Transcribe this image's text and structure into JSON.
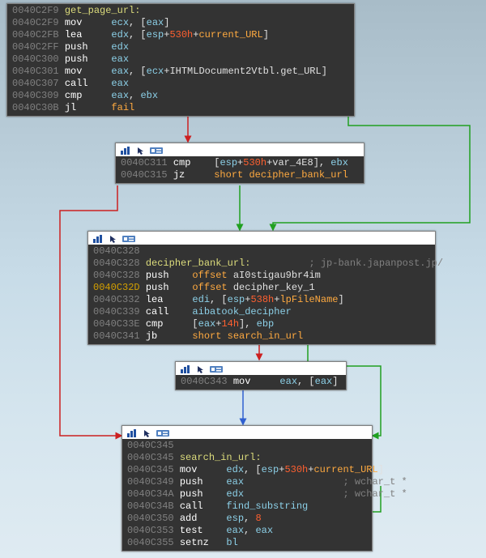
{
  "block1": {
    "rows": [
      {
        "addr": "0040C2F9",
        "label": "get_page_url:"
      },
      {
        "addr": "0040C2F9",
        "mnem": "mov",
        "ops": [
          {
            "t": "reg",
            "v": "ecx"
          },
          {
            "t": "p",
            "v": ", ["
          },
          {
            "t": "reg",
            "v": "eax"
          },
          {
            "t": "p",
            "v": "]"
          }
        ]
      },
      {
        "addr": "0040C2FB",
        "mnem": "lea",
        "ops": [
          {
            "t": "reg",
            "v": "edx"
          },
          {
            "t": "p",
            "v": ", ["
          },
          {
            "t": "reg",
            "v": "esp"
          },
          {
            "t": "p",
            "v": "+"
          },
          {
            "t": "num",
            "v": "530h"
          },
          {
            "t": "p",
            "v": "+"
          },
          {
            "t": "keyfail",
            "v": "current_URL"
          },
          {
            "t": "p",
            "v": "]"
          }
        ]
      },
      {
        "addr": "0040C2FF",
        "mnem": "push",
        "ops": [
          {
            "t": "reg",
            "v": "edx"
          }
        ]
      },
      {
        "addr": "0040C300",
        "mnem": "push",
        "ops": [
          {
            "t": "reg",
            "v": "eax"
          }
        ]
      },
      {
        "addr": "0040C301",
        "mnem": "mov",
        "ops": [
          {
            "t": "reg",
            "v": "eax"
          },
          {
            "t": "p",
            "v": ", ["
          },
          {
            "t": "reg",
            "v": "ecx"
          },
          {
            "t": "p",
            "v": "+"
          },
          {
            "t": "ident",
            "v": "IHTMLDocument2Vtbl.get_URL"
          },
          {
            "t": "p",
            "v": "]"
          }
        ]
      },
      {
        "addr": "0040C307",
        "mnem": "call",
        "ops": [
          {
            "t": "reg",
            "v": "eax"
          }
        ]
      },
      {
        "addr": "0040C309",
        "mnem": "cmp",
        "ops": [
          {
            "t": "reg",
            "v": "eax"
          },
          {
            "t": "p",
            "v": ", "
          },
          {
            "t": "reg",
            "v": "ebx"
          }
        ]
      },
      {
        "addr": "0040C30B",
        "mnem": "jl",
        "ops": [
          {
            "t": "keyfail",
            "v": "fail"
          }
        ]
      }
    ]
  },
  "block2": {
    "rows": [
      {
        "addr": "0040C311",
        "mnem": "cmp",
        "ops": [
          {
            "t": "p",
            "v": "["
          },
          {
            "t": "reg",
            "v": "esp"
          },
          {
            "t": "p",
            "v": "+"
          },
          {
            "t": "num",
            "v": "530h"
          },
          {
            "t": "p",
            "v": "+"
          },
          {
            "t": "ident",
            "v": "var_4E8"
          },
          {
            "t": "p",
            "v": "], "
          },
          {
            "t": "reg",
            "v": "ebx"
          }
        ]
      },
      {
        "addr": "0040C315",
        "mnem": "jz",
        "ops": [
          {
            "t": "keyfail",
            "v": "short "
          },
          {
            "t": "keyfail",
            "v": "decipher_bank_url"
          }
        ]
      }
    ]
  },
  "block3": {
    "rows": [
      {
        "addr": "0040C328"
      },
      {
        "addr": "0040C328",
        "label": "decipher_bank_url:",
        "cmt": "; jp-bank.japanpost.jp/"
      },
      {
        "addr": "0040C328",
        "mnem": "push",
        "ops": [
          {
            "t": "keyfail",
            "v": "offset "
          },
          {
            "t": "ident",
            "v": "aI0stigau9br4im"
          }
        ]
      },
      {
        "addr_hl": "0040C32D",
        "mnem": "push",
        "ops": [
          {
            "t": "keyfail",
            "v": "offset "
          },
          {
            "t": "ident",
            "v": "decipher_key_1"
          }
        ]
      },
      {
        "addr": "0040C332",
        "mnem": "lea",
        "ops": [
          {
            "t": "reg",
            "v": "edi"
          },
          {
            "t": "p",
            "v": ", ["
          },
          {
            "t": "reg",
            "v": "esp"
          },
          {
            "t": "p",
            "v": "+"
          },
          {
            "t": "num",
            "v": "538h"
          },
          {
            "t": "p",
            "v": "+"
          },
          {
            "t": "keyfail",
            "v": "lpFileName"
          },
          {
            "t": "p",
            "v": "]"
          }
        ]
      },
      {
        "addr": "0040C339",
        "mnem": "call",
        "ops": [
          {
            "t": "func",
            "v": "aibatook_decipher"
          }
        ]
      },
      {
        "addr": "0040C33E",
        "mnem": "cmp",
        "ops": [
          {
            "t": "p",
            "v": "["
          },
          {
            "t": "reg",
            "v": "eax"
          },
          {
            "t": "p",
            "v": "+"
          },
          {
            "t": "num",
            "v": "14h"
          },
          {
            "t": "p",
            "v": "], "
          },
          {
            "t": "reg",
            "v": "ebp"
          }
        ]
      },
      {
        "addr": "0040C341",
        "mnem": "jb",
        "ops": [
          {
            "t": "keyfail",
            "v": "short "
          },
          {
            "t": "keyfail",
            "v": "search_in_url"
          }
        ]
      }
    ]
  },
  "block4": {
    "rows": [
      {
        "addr": "0040C343",
        "mnem": "mov",
        "ops": [
          {
            "t": "reg",
            "v": "eax"
          },
          {
            "t": "p",
            "v": ", ["
          },
          {
            "t": "reg",
            "v": "eax"
          },
          {
            "t": "p",
            "v": "]"
          }
        ]
      }
    ]
  },
  "block5": {
    "rows": [
      {
        "addr": "0040C345"
      },
      {
        "addr": "0040C345",
        "label": "search_in_url:"
      },
      {
        "addr": "0040C345",
        "mnem": "mov",
        "ops": [
          {
            "t": "reg",
            "v": "edx"
          },
          {
            "t": "p",
            "v": ", ["
          },
          {
            "t": "reg",
            "v": "esp"
          },
          {
            "t": "p",
            "v": "+"
          },
          {
            "t": "num",
            "v": "530h"
          },
          {
            "t": "p",
            "v": "+"
          },
          {
            "t": "keyfail",
            "v": "current_URL"
          },
          {
            "t": "p",
            "v": "]"
          }
        ]
      },
      {
        "addr": "0040C349",
        "mnem": "push",
        "ops": [
          {
            "t": "reg",
            "v": "eax"
          }
        ],
        "cmt": "; wchar_t *"
      },
      {
        "addr": "0040C34A",
        "mnem": "push",
        "ops": [
          {
            "t": "reg",
            "v": "edx"
          }
        ],
        "cmt": "; wchar_t *"
      },
      {
        "addr": "0040C34B",
        "mnem": "call",
        "ops": [
          {
            "t": "func",
            "v": "find_substring"
          }
        ]
      },
      {
        "addr": "0040C350",
        "mnem": "add",
        "ops": [
          {
            "t": "reg",
            "v": "esp"
          },
          {
            "t": "p",
            "v": ", "
          },
          {
            "t": "num",
            "v": "8"
          }
        ]
      },
      {
        "addr": "0040C353",
        "mnem": "test",
        "ops": [
          {
            "t": "reg",
            "v": "eax"
          },
          {
            "t": "p",
            "v": ", "
          },
          {
            "t": "reg",
            "v": "eax"
          }
        ]
      },
      {
        "addr": "0040C355",
        "mnem": "setnz",
        "ops": [
          {
            "t": "reg",
            "v": "bl"
          }
        ]
      }
    ]
  },
  "icons": {
    "bar": "bar-chart-icon",
    "cursor": "cursor-icon",
    "badge": "badge-icon"
  }
}
